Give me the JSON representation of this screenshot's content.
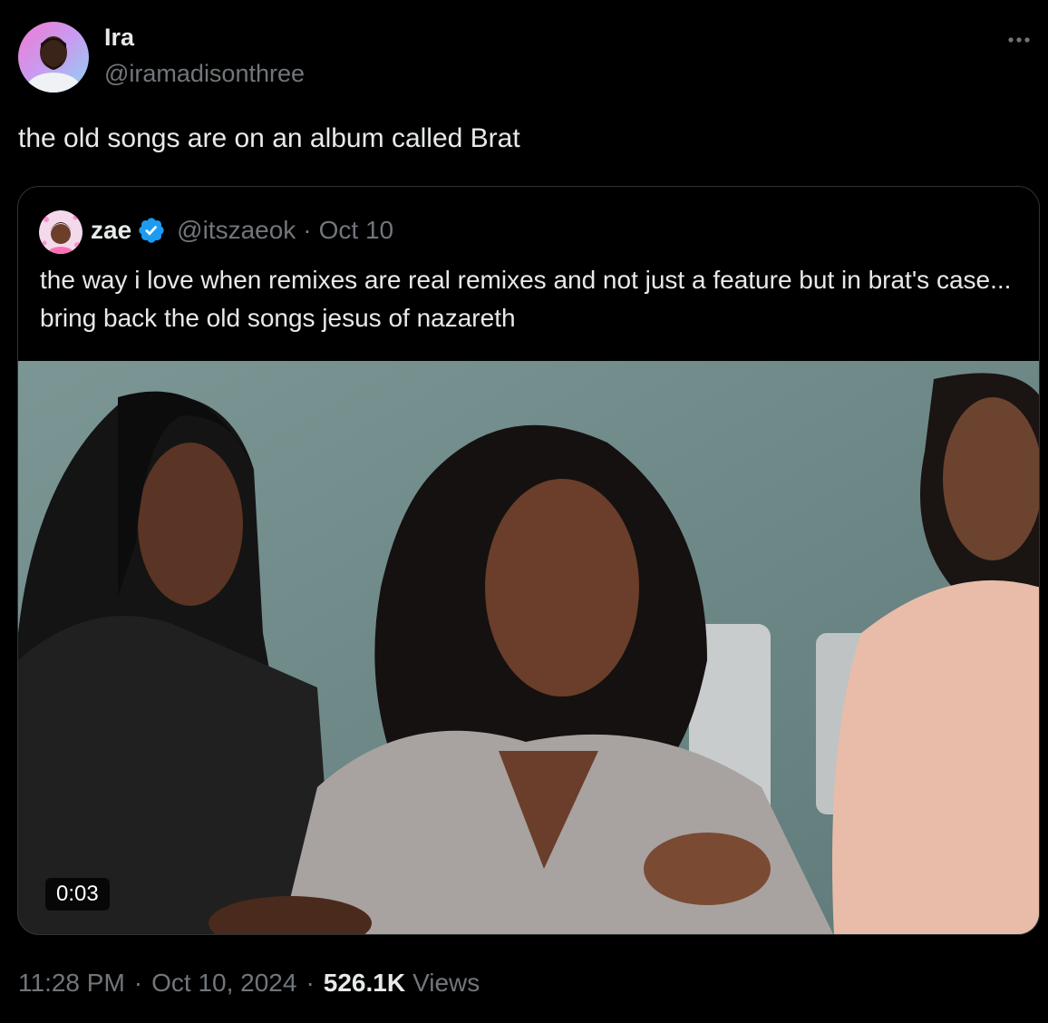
{
  "author": {
    "display_name": "Ira",
    "handle": "@iramadisonthree",
    "avatar_icon": "user-avatar"
  },
  "tweet": {
    "text": "the old songs are on an album called Brat"
  },
  "quoted": {
    "display_name": "zae",
    "handle": "@itszaeok",
    "separator": "·",
    "date": "Oct 10",
    "verified": true,
    "text": "the way i love when remixes are real remixes and not just a feature but in brat's case... bring back the old songs jesus of nazareth",
    "video": {
      "duration": "0:03"
    }
  },
  "meta": {
    "time": "11:28 PM",
    "separator": "·",
    "date": "Oct 10, 2024",
    "views_count": "526.1K",
    "views_label": "Views"
  },
  "colors": {
    "background": "#000000",
    "text_primary": "#e7e9ea",
    "text_secondary": "#71767b",
    "border": "#2f3336",
    "verified_blue": "#1d9bf0"
  },
  "icons": {
    "more": "more-horizontal-icon",
    "verified": "verified-badge-icon"
  }
}
